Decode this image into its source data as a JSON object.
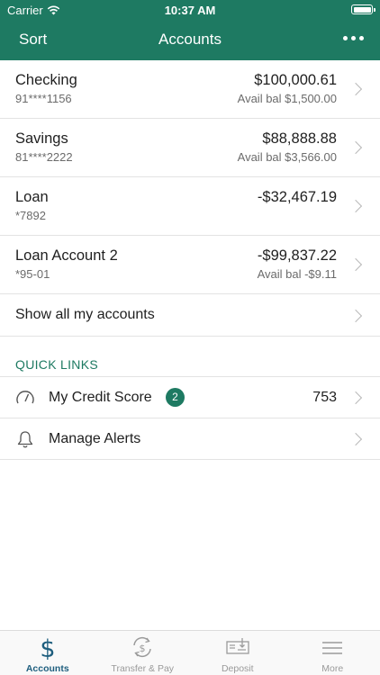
{
  "status": {
    "carrier": "Carrier",
    "time": "10:37 AM"
  },
  "nav": {
    "sort_label": "Sort",
    "title": "Accounts",
    "more_icon": "more-dots-icon"
  },
  "accounts": [
    {
      "name": "Checking",
      "number": "91****1156",
      "amount": "$100,000.61",
      "avail": "Avail bal $1,500.00"
    },
    {
      "name": "Savings",
      "number": "81****2222",
      "amount": "$88,888.88",
      "avail": "Avail bal $3,566.00"
    },
    {
      "name": "Loan",
      "number": "*7892",
      "amount": "-$32,467.19",
      "avail": ""
    },
    {
      "name": "Loan Account 2",
      "number": "*95-01",
      "amount": "-$99,837.22",
      "avail": "Avail bal -$9.11"
    }
  ],
  "show_all_label": "Show all my accounts",
  "quick_links": {
    "heading": "QUICK LINKS",
    "items": [
      {
        "label": "My Credit Score",
        "badge": "2",
        "value": "753",
        "icon": "gauge-icon"
      },
      {
        "label": "Manage Alerts",
        "badge": "",
        "value": "",
        "icon": "bell-icon"
      }
    ]
  },
  "tabs": [
    {
      "label": "Accounts",
      "icon": "dollar-icon",
      "active": true
    },
    {
      "label": "Transfer & Pay",
      "icon": "transfer-icon",
      "active": false
    },
    {
      "label": "Deposit",
      "icon": "check-deposit-icon",
      "active": false
    },
    {
      "label": "More",
      "icon": "menu-icon",
      "active": false
    }
  ],
  "colors": {
    "brand": "#1e7a62",
    "active_tab": "#1e5e7e"
  }
}
